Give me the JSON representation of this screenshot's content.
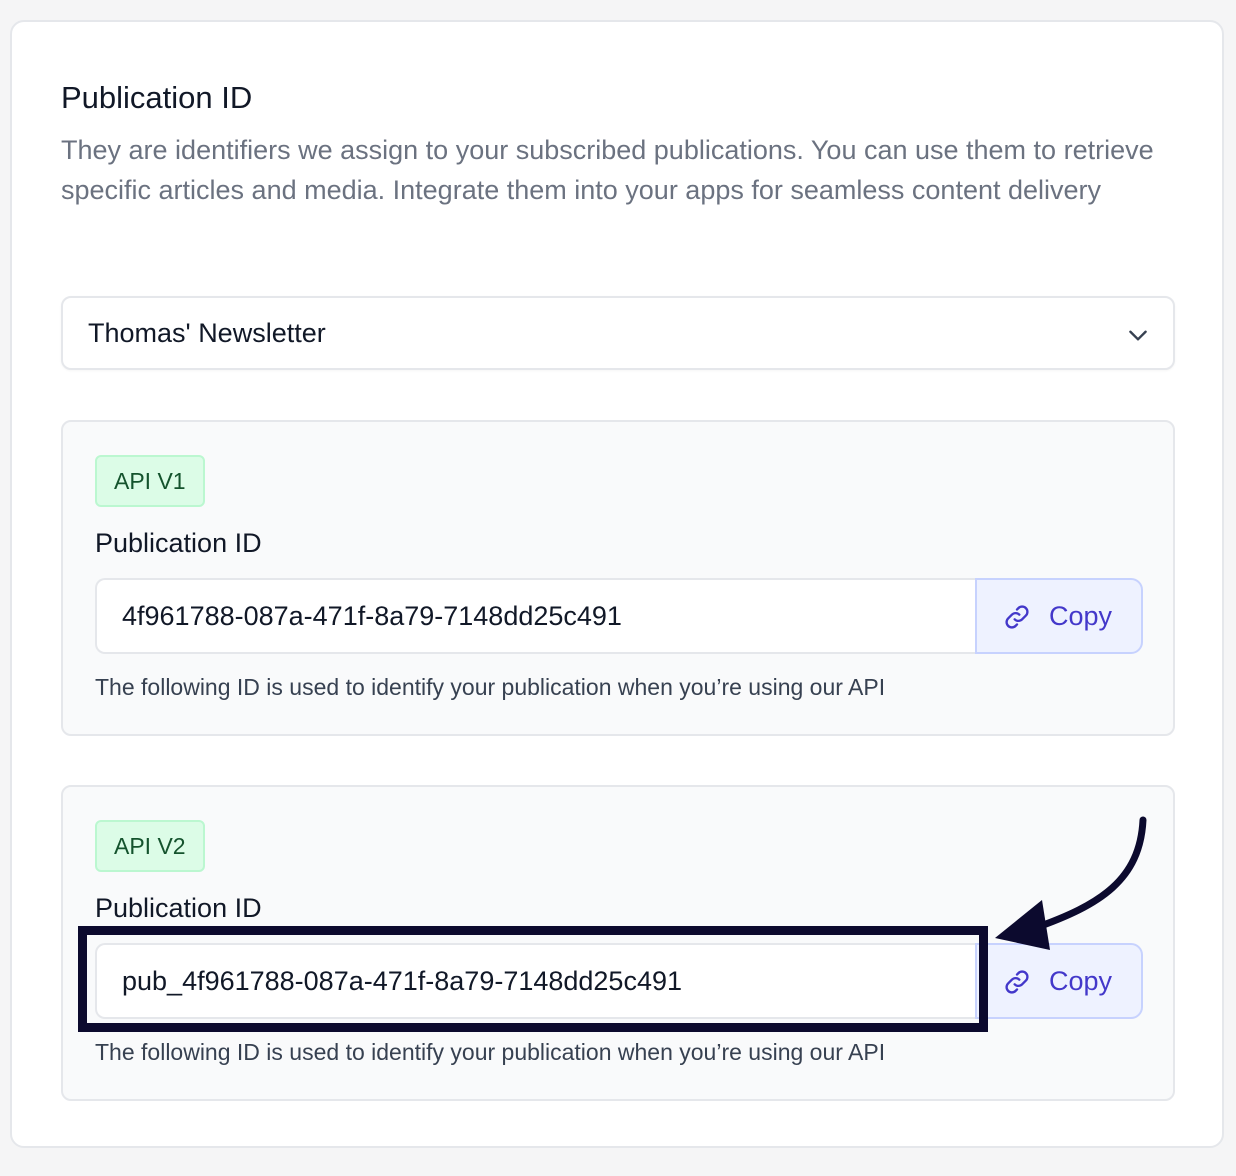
{
  "section": {
    "title": "Publication ID",
    "description": "They are identifiers we assign to your subscribed publications. You can use them to retrieve specific articles and media. Integrate them into your apps for seamless content delivery"
  },
  "publication_select": {
    "selected": "Thomas' Newsletter",
    "icon": "chevron-down-icon"
  },
  "panels": [
    {
      "badge": "API V1",
      "label": "Publication ID",
      "value": "4f961788-087a-471f-8a79-7148dd25c491",
      "copy_label": "Copy",
      "helper": "The following ID is used to identify your publication when you’re using our API"
    },
    {
      "badge": "API V2",
      "label": "Publication ID",
      "value": "pub_4f961788-087a-471f-8a79-7148dd25c491",
      "copy_label": "Copy",
      "helper": "The following ID is used to identify your publication when you’re using our API"
    }
  ],
  "colors": {
    "accent": "#4338ca",
    "badge_bg": "#dcfce7",
    "badge_text": "#14532d",
    "annotation": "#0c0a2e"
  }
}
